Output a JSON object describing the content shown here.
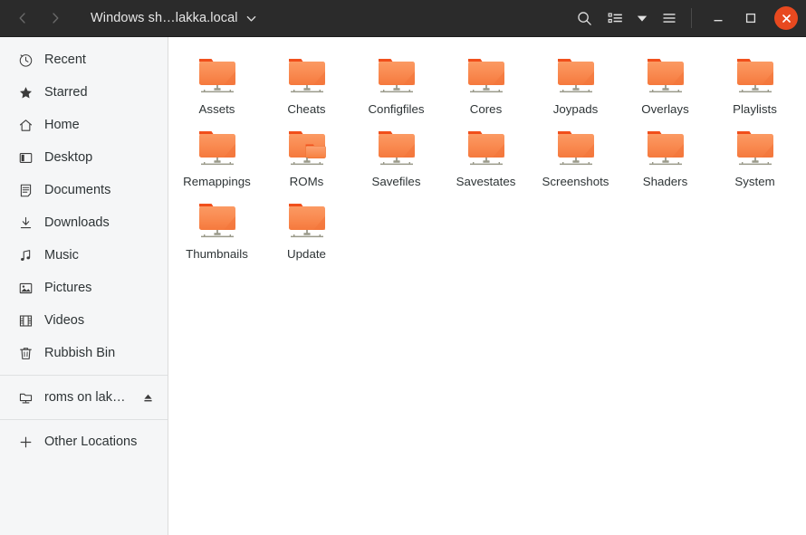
{
  "window": {
    "title": "Windows sh…lakka.local",
    "titlebar_bg": "#2b2b2b",
    "close_color": "#e8491f"
  },
  "headerbar": {
    "back_icon": "chevron-left-icon",
    "forward_icon": "chevron-right-icon",
    "path_dropdown_icon": "chevron-down-icon",
    "search_icon": "search-icon",
    "view_list_icon": "list-view-icon",
    "view_dropdown_icon": "triangle-down-icon",
    "menu_icon": "hamburger-menu-icon",
    "minimize_icon": "minimize-icon",
    "maximize_icon": "maximize-icon",
    "close_icon": "close-icon"
  },
  "sidebar": {
    "groups": [
      {
        "items": [
          {
            "label": "Recent",
            "icon": "clock-icon",
            "eject": false
          },
          {
            "label": "Starred",
            "icon": "star-icon",
            "eject": false
          },
          {
            "label": "Home",
            "icon": "home-icon",
            "eject": false
          },
          {
            "label": "Desktop",
            "icon": "desktop-icon",
            "eject": false
          },
          {
            "label": "Documents",
            "icon": "document-icon",
            "eject": false
          },
          {
            "label": "Downloads",
            "icon": "download-icon",
            "eject": false
          },
          {
            "label": "Music",
            "icon": "music-note-icon",
            "eject": false
          },
          {
            "label": "Pictures",
            "icon": "picture-icon",
            "eject": false
          },
          {
            "label": "Videos",
            "icon": "film-icon",
            "eject": false
          },
          {
            "label": "Rubbish Bin",
            "icon": "trash-icon",
            "eject": false
          }
        ]
      },
      {
        "items": [
          {
            "label": "roms on lakk…",
            "icon": "network-share-icon",
            "eject": true
          }
        ]
      },
      {
        "items": [
          {
            "label": "Other Locations",
            "icon": "plus-icon",
            "eject": false
          }
        ]
      }
    ]
  },
  "files": {
    "folder_color_top": "#f04d1e",
    "folder_color_body": "#f98a52",
    "items": [
      {
        "name": "Assets",
        "icon": "network-folder-icon"
      },
      {
        "name": "Cheats",
        "icon": "network-folder-icon"
      },
      {
        "name": "Configfiles",
        "icon": "network-folder-icon"
      },
      {
        "name": "Cores",
        "icon": "network-folder-icon"
      },
      {
        "name": "Joypads",
        "icon": "network-folder-icon"
      },
      {
        "name": "Overlays",
        "icon": "network-folder-icon"
      },
      {
        "name": "Playlists",
        "icon": "network-folder-icon"
      },
      {
        "name": "Remappings",
        "icon": "network-folder-icon"
      },
      {
        "name": "ROMs",
        "icon": "network-folder-with-subfolder-icon"
      },
      {
        "name": "Savefiles",
        "icon": "network-folder-icon"
      },
      {
        "name": "Savestates",
        "icon": "network-folder-icon"
      },
      {
        "name": "Screenshots",
        "icon": "network-folder-icon"
      },
      {
        "name": "Shaders",
        "icon": "network-folder-icon"
      },
      {
        "name": "System",
        "icon": "network-folder-icon"
      },
      {
        "name": "Thumbnails",
        "icon": "network-folder-icon"
      },
      {
        "name": "Update",
        "icon": "network-folder-icon"
      }
    ]
  }
}
